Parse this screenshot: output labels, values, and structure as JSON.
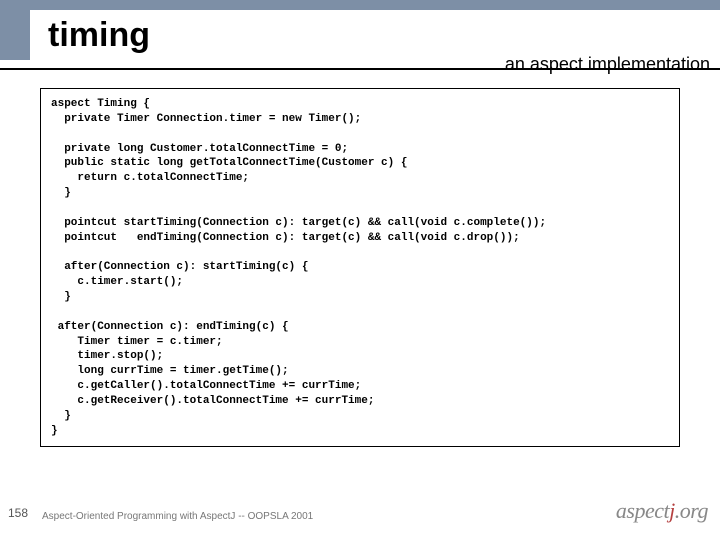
{
  "header": {
    "title": "timing",
    "subtitle": "an aspect implementation"
  },
  "code": "aspect Timing {\n  private Timer Connection.timer = new Timer();\n\n  private long Customer.totalConnectTime = 0;\n  public static long getTotalConnectTime(Customer c) {\n    return c.totalConnectTime;\n  }\n\n  pointcut startTiming(Connection c): target(c) && call(void c.complete());\n  pointcut   endTiming(Connection c): target(c) && call(void c.drop());\n\n  after(Connection c): startTiming(c) {\n    c.timer.start();\n  }\n\n after(Connection c): endTiming(c) {\n    Timer timer = c.timer;\n    timer.stop();\n    long currTime = timer.getTime();\n    c.getCaller().totalConnectTime += currTime;\n    c.getReceiver().totalConnectTime += currTime;\n  }\n}",
  "footer": {
    "page_number": "158",
    "text": "Aspect-Oriented Programming with AspectJ -- OOPSLA 2001",
    "logo_aspect": "aspect",
    "logo_j": "j",
    "logo_org": ".org"
  }
}
